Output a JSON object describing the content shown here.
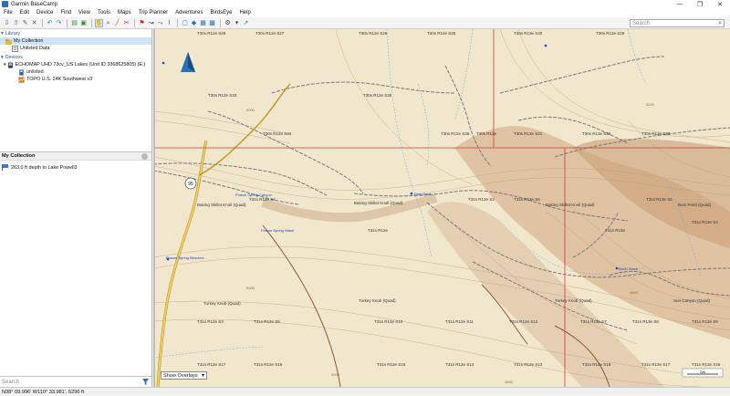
{
  "app": {
    "title": "Garmin BaseCamp"
  },
  "window_controls": {
    "minimize": "—",
    "maximize": "❐",
    "close": "✕"
  },
  "menu": [
    "File",
    "Edit",
    "Device",
    "Find",
    "View",
    "Tools",
    "Maps",
    "Trip Planner",
    "Adventures",
    "BirdsEye",
    "Help"
  ],
  "search": {
    "placeholder": "Search"
  },
  "library": {
    "library_label": "Library",
    "my_collection": "My Collection",
    "unlisted_data": "Unlisted Data",
    "devices_label": "Devices",
    "device_name": "ECHOMAP UHD 73cv_US Lakes (Unit ID 3368625805) (E:)",
    "device_sub": "unlisted",
    "map_product": "TOPO U.S. 24K Southwest v3"
  },
  "collection_panel": {
    "title": "My Collection",
    "items": [
      "263.0 ft depth to Lake Powell3"
    ],
    "search_placeholder": "Search"
  },
  "map": {
    "overlay_select": "Show Overlays",
    "township_labels": [
      "T30s R12e S28",
      "T30s R12e S27",
      "T30s R12e S26",
      "T30s R12e S25",
      "T30s R13e S30",
      "T30s R13e S29",
      "T30s R12e S33",
      "T30s R12e S35",
      "T30s R12e S34",
      "T30s R12e S36",
      "T30s R13e",
      "T30s R13e S31",
      "T30s R13e S32",
      "T30s R13e S33",
      "T31s R12e S4",
      "T31s R12e S2",
      "T31s R13e S6",
      "T31s R13e S5",
      "T31s R13e S4",
      "T31s R12e",
      "T31s R13e",
      "T31s R12e S10",
      "T31s R12e S11",
      "T31s R12e S12",
      "T31s R13e S7",
      "T31s R13e S8",
      "T31s R13e S9",
      "T31s R12e S15",
      "T31s R12e S16",
      "T31s R12e S17",
      "T31s R12e S13",
      "T31s R13e S18",
      "T31s R13e S17",
      "T31s R12e S3",
      "T31s R12e S5",
      "T31s R13e S16",
      "T31s R12e S14"
    ],
    "place_labels": [
      "Baking Skillet Knoll (Quad)",
      "Baking Skillet Knoll (Quad)",
      "Baking Skillet Knoll (Quad)",
      "Bum Point (Quad)",
      "Turkey Knob (Quad)",
      "Turkey Knob (Quad)",
      "Turkey Knob (Quad)",
      "Sun Canyon (Quad)",
      "Poison Spring Benches",
      "Poison Spring Canyon",
      "Poison Spring Wash",
      "Dirty Devil",
      "North Wash"
    ],
    "highway": "95",
    "contour_labels": [
      "5000",
      "5200",
      "5000",
      "4800",
      "4600",
      "5000"
    ],
    "scale": "2mi"
  },
  "status": {
    "coordinates": "N38° 09.996' W110° 33.981', 5296 ft"
  }
}
